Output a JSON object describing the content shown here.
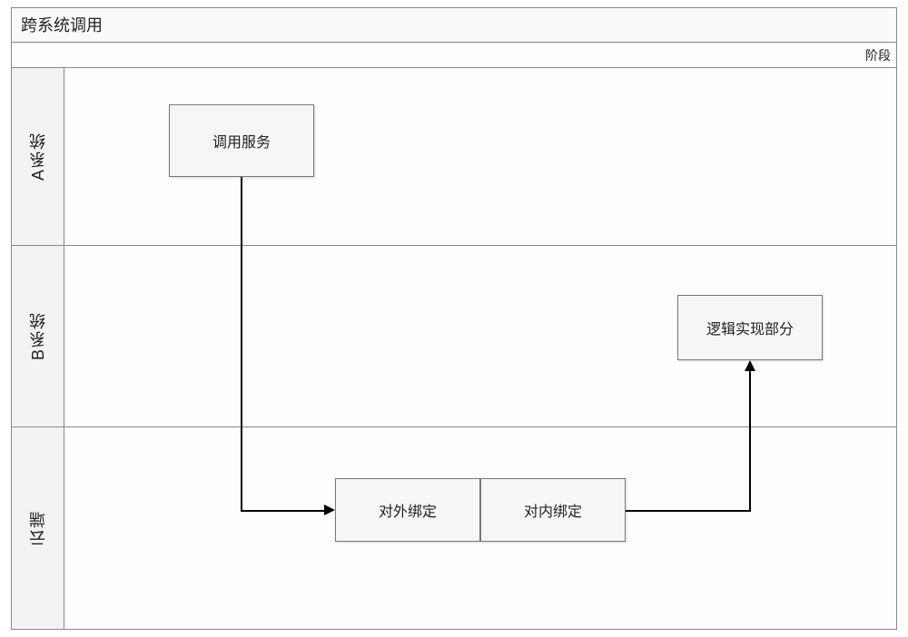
{
  "diagram": {
    "title": "跨系统调用",
    "phase_label": "阶段",
    "lanes": {
      "a": "A系统",
      "b": "B系统",
      "cloud": "云端"
    },
    "nodes": {
      "call_service": "调用服务",
      "external_binding": "对外绑定",
      "internal_binding": "对内绑定",
      "logic_impl": "逻辑实现部分"
    }
  }
}
